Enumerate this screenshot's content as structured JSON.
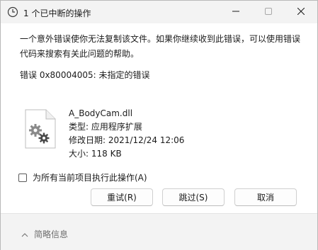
{
  "window": {
    "title": "1 个已中断的操作",
    "icons": {
      "app": "clock-icon",
      "minimize": "minimize-icon",
      "maximize": "maximize-icon",
      "close": "close-icon"
    }
  },
  "message": {
    "text": "一个意外错误使你无法复制该文件。如果你继续收到此错误，可以使用错误代码来搜索有关此问题的帮助。",
    "error": "错误 0x80004005: 未指定的错误"
  },
  "file": {
    "icon": "settings-file-icon",
    "name": "A_BodyCam.dll",
    "type": "类型: 应用程序扩展",
    "modified": "修改日期: 2021/12/24 12:06",
    "size": "大小: 118 KB"
  },
  "apply_all": {
    "label": "为所有当前项目执行此操作(A)",
    "checked": false
  },
  "buttons": {
    "retry": "重试(R)",
    "skip": "跳过(S)",
    "cancel": "取消"
  },
  "footer": {
    "details": "简略信息",
    "icon": "chevron-up-icon"
  }
}
